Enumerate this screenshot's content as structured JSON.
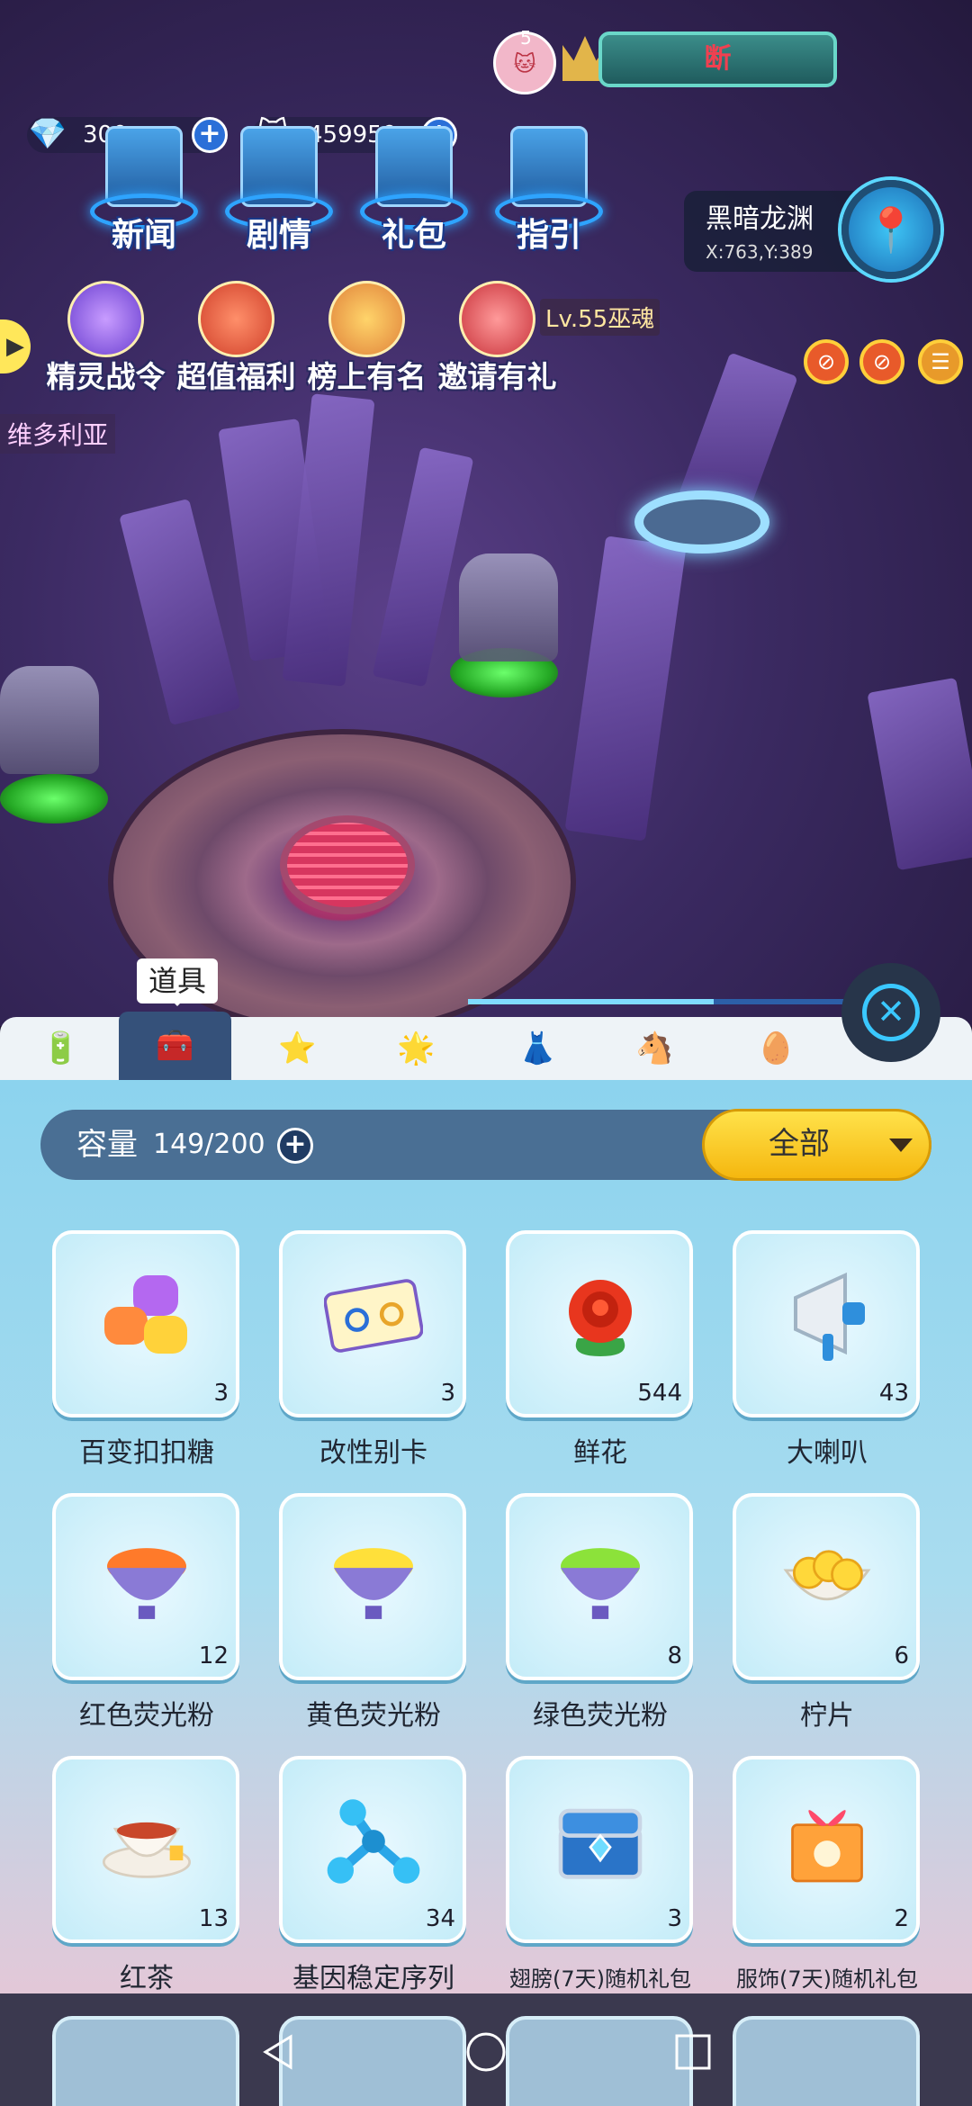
{
  "hud": {
    "banner_text": "断",
    "badge_count": "5",
    "diamonds": "300",
    "coins": "459959",
    "menu": [
      "新闻",
      "剧情",
      "礼包",
      "指引"
    ],
    "events": [
      "精灵战令",
      "超值福利",
      "榜上有名",
      "邀请有礼"
    ],
    "location_name": "黑暗龙渊",
    "location_coords": "X:763,Y:389",
    "npc_level_label": "Lv.55巫魂",
    "npc_name": "维多利亚",
    "pass_progress": 0.65
  },
  "tabs": {
    "tooltip": "道具",
    "items": [
      {
        "icon": "battery-icon",
        "glyph": "🔋"
      },
      {
        "icon": "item-box-icon",
        "glyph": "🧰"
      },
      {
        "icon": "magic-wand-icon",
        "glyph": "⭐"
      },
      {
        "icon": "star-frame-icon",
        "glyph": "🌟"
      },
      {
        "icon": "dress-icon",
        "glyph": "👗"
      },
      {
        "icon": "rocking-horse-icon",
        "glyph": "🐴"
      },
      {
        "icon": "egg-icon",
        "glyph": "🥚"
      }
    ]
  },
  "bag": {
    "capacity_label": "容量",
    "capacity_value": "149/200",
    "filter_label": "全部",
    "items": [
      {
        "name": "百变扣扣糖",
        "count": "3",
        "icon": "gummy-candy-icon",
        "glyph": "🍬"
      },
      {
        "name": "改性别卡",
        "count": "3",
        "icon": "gender-card-icon",
        "glyph": "⚥"
      },
      {
        "name": "鲜花",
        "count": "544",
        "icon": "rose-icon",
        "glyph": "🌹"
      },
      {
        "name": "大喇叭",
        "count": "43",
        "icon": "megaphone-icon",
        "glyph": "📢"
      },
      {
        "name": "红色荧光粉",
        "count": "12",
        "icon": "red-powder-bowl-icon",
        "glyph": "🥣"
      },
      {
        "name": "黄色荧光粉",
        "count": "",
        "icon": "yellow-powder-bowl-icon",
        "glyph": "🥣"
      },
      {
        "name": "绿色荧光粉",
        "count": "8",
        "icon": "green-powder-bowl-icon",
        "glyph": "🥣"
      },
      {
        "name": "柠片",
        "count": "6",
        "icon": "lemon-slices-icon",
        "glyph": "🍋"
      },
      {
        "name": "红茶",
        "count": "13",
        "icon": "tea-cup-icon",
        "glyph": "🍵"
      },
      {
        "name": "基因稳定序列",
        "count": "34",
        "icon": "molecule-icon",
        "glyph": "🧬"
      },
      {
        "name": "翅膀(7天)随机礼包",
        "count": "3",
        "icon": "wing-chest-icon",
        "glyph": "🎁"
      },
      {
        "name": "服饰(7天)随机礼包",
        "count": "2",
        "icon": "costume-gift-box-icon",
        "glyph": "🎀"
      }
    ]
  },
  "colors": {
    "capacity_bar": "#4a6f94",
    "filter_button": "#f5c51a",
    "panel_top": "#8cd3ee",
    "active_tab": "#35517a"
  }
}
